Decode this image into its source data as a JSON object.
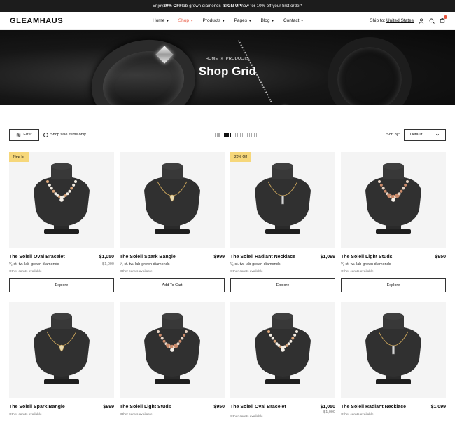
{
  "announcement": {
    "pre": "Enjoy ",
    "bold1": "20% OFF",
    "mid": " lab-grown diamonds | ",
    "bold2": "SIGN UP",
    "post": " now for 10% off your first order*"
  },
  "brand": "GLEAMHAUS",
  "nav": [
    {
      "label": "Home",
      "active": false
    },
    {
      "label": "Shop",
      "active": true
    },
    {
      "label": "Products",
      "active": false
    },
    {
      "label": "Pages",
      "active": false
    },
    {
      "label": "Blog",
      "active": false
    },
    {
      "label": "Contact",
      "active": false
    }
  ],
  "ship_to": {
    "label": "Ship to:",
    "country": "United States"
  },
  "icons": {
    "account": "user-icon",
    "search": "search-icon",
    "cart": "cart-icon"
  },
  "hero": {
    "crumb_home": "HOME",
    "crumb_sep": "»",
    "crumb_current": "PRODUCTS",
    "title": "Shop Grid"
  },
  "toolbar": {
    "filter_label": "Filter",
    "sale_label": "Shop sale items only",
    "sort_label": "Sort by:",
    "sort_value": "Default"
  },
  "products": [
    {
      "badge": "New In",
      "title": "The Soleil Oval Bracelet",
      "price": "$1,050",
      "old_price": "$1,090",
      "carat": "¹⁄₂ ct. tw. lab-grown diamonds",
      "note": "Other carats available",
      "cta": "Explore",
      "necklace": "pearl"
    },
    {
      "badge": "",
      "title": "The Soleil Spark Bangle",
      "price": "$999",
      "old_price": "",
      "carat": "¹⁄₂ ct. tw. lab-grown diamonds",
      "note": "Other carats available",
      "cta": "Add To Cart",
      "necklace": "heart"
    },
    {
      "badge": "20% Off",
      "title": "The Soleil Radiant Necklace",
      "price": "$1,099",
      "old_price": "",
      "carat": "¹⁄₂ ct. tw. lab-grown diamonds",
      "note": "Other carats available",
      "cta": "Explore",
      "necklace": "bar"
    },
    {
      "badge": "",
      "title": "The Soleil Light Studs",
      "price": "$950",
      "old_price": "",
      "carat": "¹⁄₂ ct. tw. lab-grown diamonds",
      "note": "Other carats available",
      "cta": "Explore",
      "necklace": "stone"
    },
    {
      "badge": "",
      "title": "The Soleil Spark Bangle",
      "price": "$999",
      "old_price": "",
      "carat": "",
      "note": "Other carats available",
      "cta": "",
      "necklace": "heart"
    },
    {
      "badge": "",
      "title": "The Soleil Light Studs",
      "price": "$950",
      "old_price": "",
      "carat": "",
      "note": "Other carats available",
      "cta": "",
      "necklace": "stone"
    },
    {
      "badge": "",
      "title": "The Soleil Oval Bracelet",
      "price": "$1,050",
      "old_price": "$1,090",
      "carat": "",
      "note": "Other carats available",
      "cta": "",
      "necklace": "pearl"
    },
    {
      "badge": "",
      "title": "The Soleil Radiant Necklace",
      "price": "$1,099",
      "old_price": "",
      "carat": "",
      "note": "Other carats available",
      "cta": "",
      "necklace": "bar"
    }
  ]
}
